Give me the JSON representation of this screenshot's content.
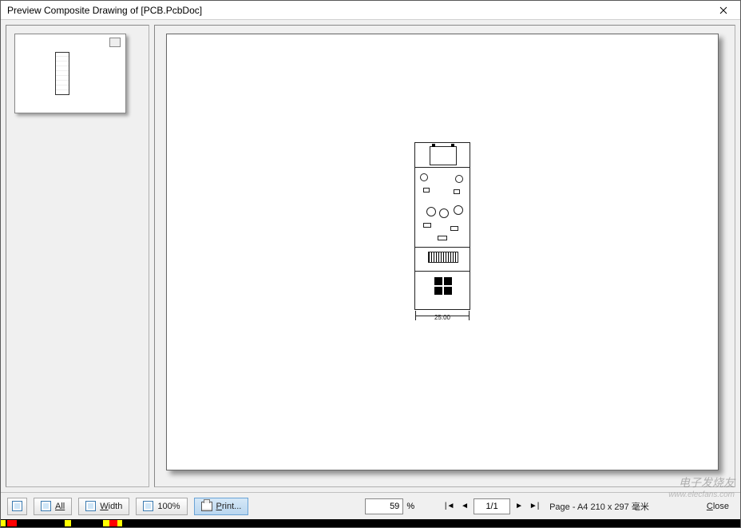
{
  "window": {
    "title": "Preview Composite Drawing of [PCB.PcbDoc]"
  },
  "toolbar": {
    "all_label": "All",
    "width_label": "Width",
    "p100_label": "100%",
    "print_label": "Print..."
  },
  "zoom": {
    "value": "59",
    "suffix": "%"
  },
  "pagenav": {
    "value": "1/1",
    "info": "Page - A4 210 x 297 毫米"
  },
  "footer": {
    "close_label": "Close"
  },
  "pcb": {
    "width_dim": "25.00"
  },
  "watermark": {
    "line1": "电子发烧友",
    "line2": "www.elecfans.com"
  }
}
